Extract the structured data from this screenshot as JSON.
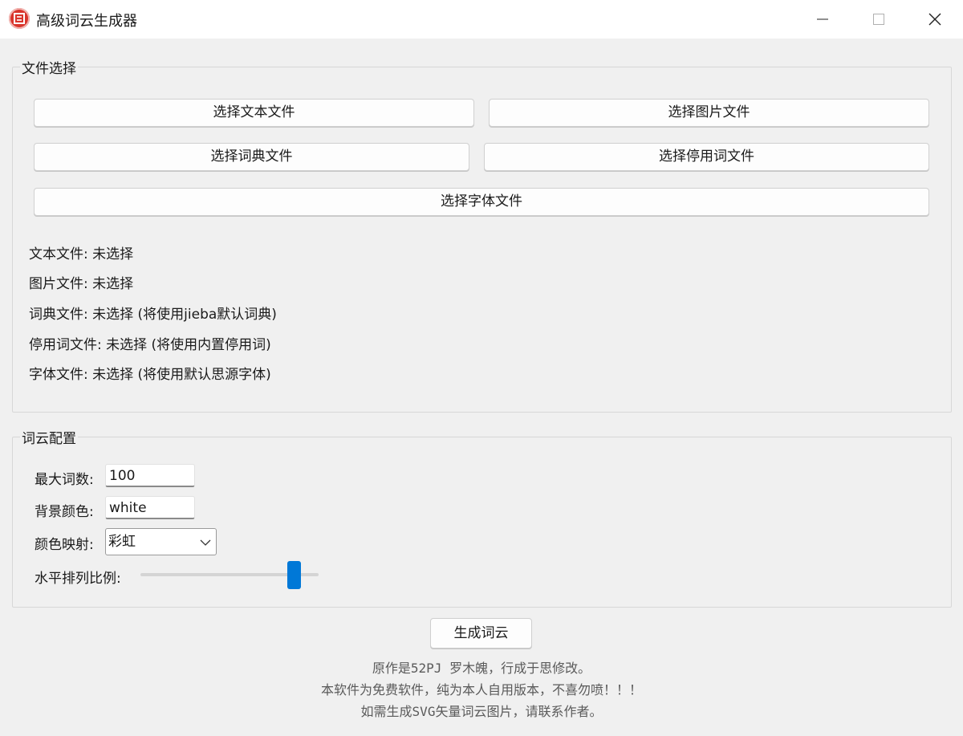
{
  "window": {
    "title": "高级词云生成器",
    "icon": "ci-logo-icon",
    "controls": [
      "minimize-icon",
      "maximize-icon",
      "close-icon"
    ]
  },
  "file_section": {
    "title": "文件选择",
    "buttons": {
      "text_file": "选择文本文件",
      "image_file": "选择图片文件",
      "dict_file": "选择词典文件",
      "stopword_file": "选择停用词文件",
      "font_file": "选择字体文件"
    },
    "status": {
      "text_file": "文本文件: 未选择",
      "image_file": "图片文件: 未选择",
      "dict_file": "词典文件: 未选择 (将使用jieba默认词典)",
      "stopword_file": "停用词文件: 未选择 (将使用内置停用词)",
      "font_file": "字体文件: 未选择 (将使用默认思源字体)"
    }
  },
  "config_section": {
    "title": "词云配置",
    "max_words": {
      "label": "最大词数:",
      "value": "100"
    },
    "background_color": {
      "label": "背景颜色:",
      "value": "white"
    },
    "colormap": {
      "label": "颜色映射:",
      "selected": "彩虹"
    },
    "horizontal_ratio": {
      "label": "水平排列比例:",
      "value": 0.85
    }
  },
  "actions": {
    "generate": "生成词云"
  },
  "footer": {
    "line1": "原作是52PJ 罗木魄，行成于思修改。",
    "line2": "本软件为免费软件，纯为本人自用版本，不喜勿喷！！！",
    "line3": "如需生成SVG矢量词云图片，请联系作者。"
  },
  "colors": {
    "accent": "#0078d7",
    "icon_red": "#d9342b"
  }
}
